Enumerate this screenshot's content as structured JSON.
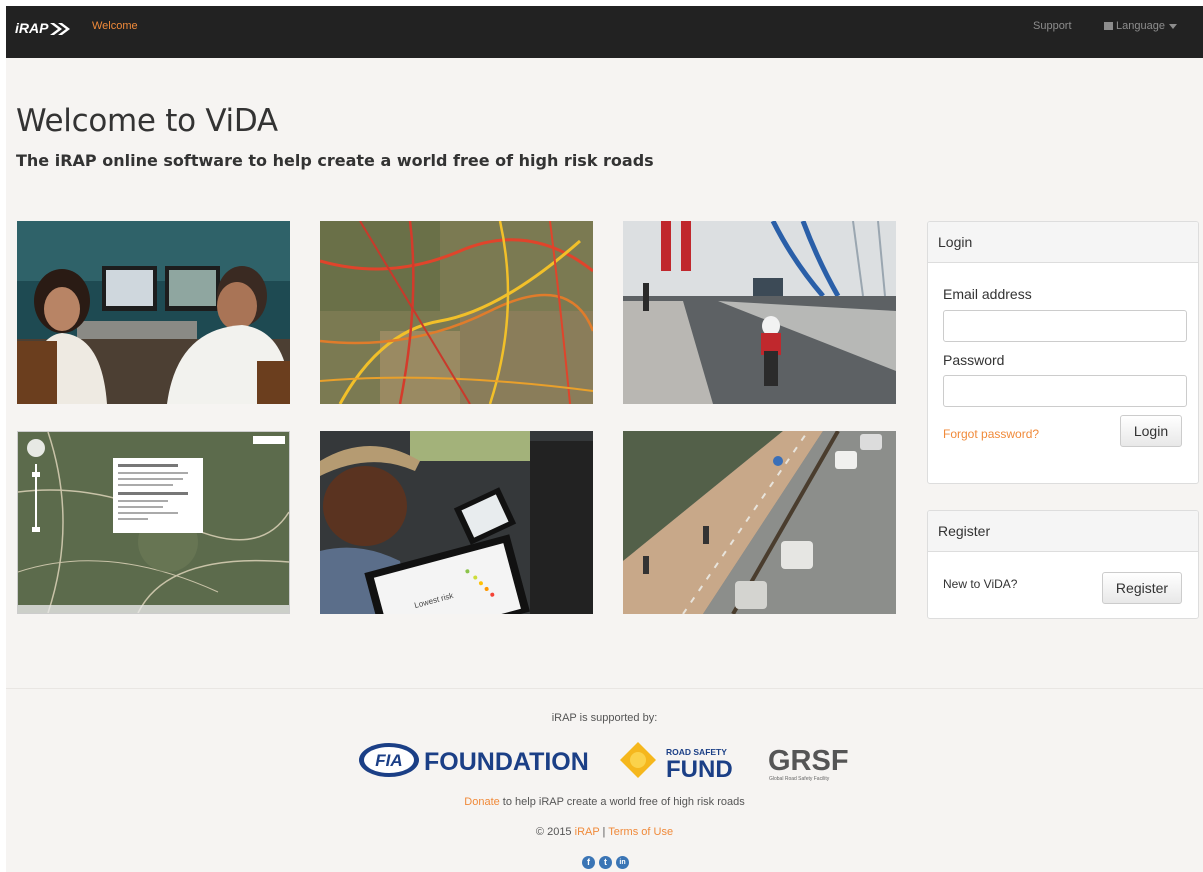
{
  "navbar": {
    "brand": "iRAP",
    "welcome": "Welcome",
    "support": "Support",
    "language": "Language"
  },
  "hero": {
    "title": "Welcome to ViDA",
    "subtitle": "The iRAP online software to help create a world free of high risk roads"
  },
  "photos": {
    "laptop_screen_text": "Lowest risk"
  },
  "login": {
    "heading": "Login",
    "email_label": "Email address",
    "email_value": "",
    "password_label": "Password",
    "password_value": "",
    "forgot": "Forgot password?",
    "button": "Login"
  },
  "register": {
    "heading": "Register",
    "prompt": "New to ViDA?",
    "button": "Register"
  },
  "footer": {
    "supported_by": "iRAP is supported by:",
    "sponsors": {
      "fia_badge": "FIA",
      "fia_name": "FOUNDATION",
      "fund_line1": "ROAD SAFETY",
      "fund_line2": "FUND",
      "grsf": "GRSF",
      "grsf_sub": "Global Road Safety Facility"
    },
    "donate_link": "Donate",
    "donate_text": " to help iRAP create a world free of high risk roads",
    "copyright": "© 2015 ",
    "irap_link": "iRAP",
    "separator": " | ",
    "terms_link": "Terms of Use",
    "social": {
      "facebook": "f",
      "twitter": "t",
      "linkedin": "in"
    }
  },
  "colors": {
    "accent": "#f08a3a",
    "navbar": "#222222",
    "background": "#f6f4f2",
    "social": "#3b75b5"
  }
}
